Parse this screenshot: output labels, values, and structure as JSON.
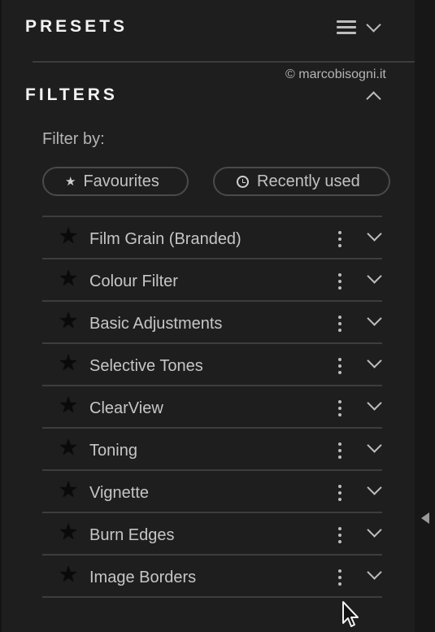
{
  "presets": {
    "title": "PRESETS",
    "menu_icon": "hamburger-icon",
    "toggle_icon": "chevron-down-icon"
  },
  "watermark": "© marcobisogni.it",
  "filters": {
    "title": "FILTERS",
    "toggle_icon": "chevron-up-icon",
    "filter_by_label": "Filter by:",
    "pills": {
      "favourites": "Favourites",
      "recently_used": "Recently used"
    },
    "items": [
      {
        "label": "Film Grain (Branded)"
      },
      {
        "label": "Colour Filter"
      },
      {
        "label": "Basic Adjustments"
      },
      {
        "label": "Selective Tones"
      },
      {
        "label": "ClearView"
      },
      {
        "label": "Toning"
      },
      {
        "label": "Vignette"
      },
      {
        "label": "Burn Edges"
      },
      {
        "label": "Image Borders"
      }
    ]
  },
  "colors": {
    "background": "#1e1e1e",
    "title_text": "#f2f2f2",
    "body_text": "#c6c6c6",
    "divider": "#3d3d3d"
  }
}
